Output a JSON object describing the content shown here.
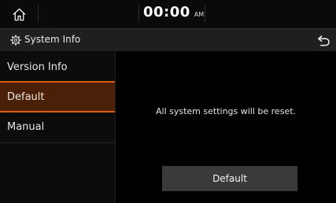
{
  "status_bar": {
    "time": "00:00",
    "ampm": "AM"
  },
  "header": {
    "title": "System Info"
  },
  "icons": {
    "home": "home-icon",
    "settings": "gear-icon",
    "back": "back-arrow-icon"
  },
  "sidebar": {
    "items": [
      {
        "label": "Version Info",
        "active": false
      },
      {
        "label": "Default",
        "active": true
      },
      {
        "label": "Manual",
        "active": false
      }
    ]
  },
  "main": {
    "message": "All system settings will be reset.",
    "default_button_label": "Default"
  },
  "colors": {
    "accent": "#d75b12",
    "active_background": "#4a2008",
    "button_background": "#3a3a3a"
  }
}
